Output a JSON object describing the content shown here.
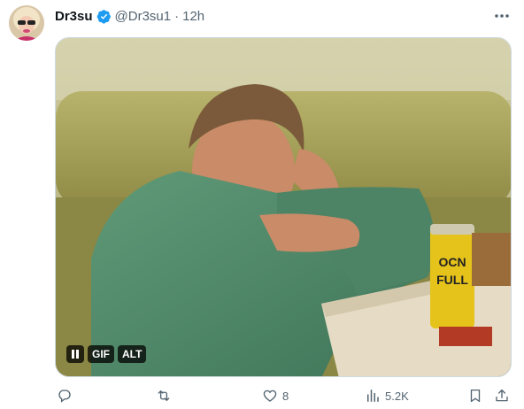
{
  "tweet": {
    "display_name": "Dr3su",
    "handle": "@Dr3su1",
    "separator": "·",
    "timestamp": "12h",
    "verified": true
  },
  "media": {
    "type": "gif",
    "can_text": "OCN FULL",
    "controls": {
      "pause_icon": "pause-icon",
      "gif_label": "GIF",
      "alt_label": "ALT"
    }
  },
  "actions": {
    "reply": {
      "icon": "reply-icon",
      "count": ""
    },
    "repost": {
      "icon": "repost-icon",
      "count": ""
    },
    "like": {
      "icon": "heart-icon",
      "count": "8"
    },
    "views": {
      "icon": "views-icon",
      "count": "5.2K"
    },
    "bookmark": {
      "icon": "bookmark-icon"
    },
    "share": {
      "icon": "share-icon"
    }
  },
  "colors": {
    "verified": "#1d9bf0",
    "text_primary": "#0f1419",
    "text_secondary": "#536471"
  }
}
